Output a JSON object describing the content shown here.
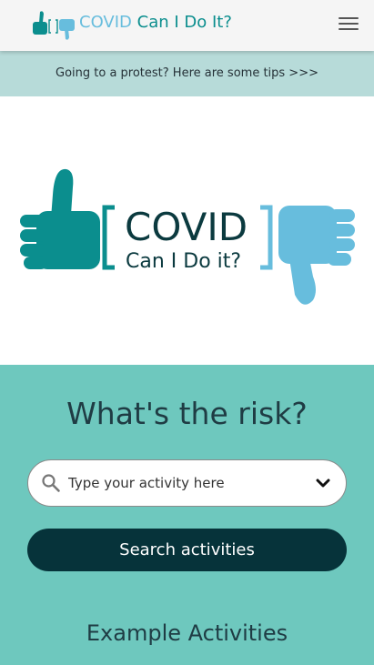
{
  "header": {
    "brand_covid": "COVID",
    "brand_rest": " Can I Do It?"
  },
  "banner": {
    "text": "Going to a protest? Here are some tips >>>"
  },
  "hero": {
    "logo_line1": "COVID",
    "logo_line2": "Can I Do it?"
  },
  "risk": {
    "title": "What's the risk?",
    "search_placeholder": "Type your activity here",
    "search_button": "Search activities",
    "examples_title": "Example Activities"
  },
  "colors": {
    "teal": "#0b8e8e",
    "light_blue": "#67bddd",
    "section_bg": "#6ec8be",
    "banner_bg": "#b7dbd9",
    "button_bg": "#06333a"
  },
  "icons": [
    "thumbs-up-icon",
    "thumbs-down-icon",
    "menu-icon",
    "search-icon",
    "chevron-down-icon"
  ]
}
